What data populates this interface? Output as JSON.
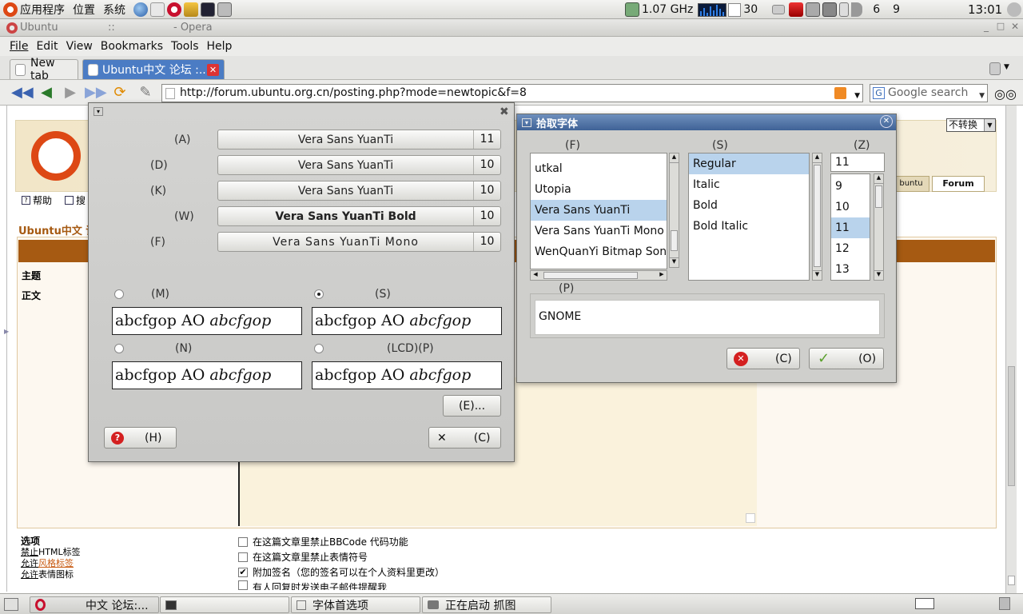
{
  "top_panel": {
    "menus": [
      "应用程序",
      "位置",
      "系统"
    ],
    "cpu_freq": "1.07 GHz",
    "cpu_value": "30",
    "tray_nums": [
      "6",
      "9"
    ],
    "clock": "13:01"
  },
  "window": {
    "title": "Ubuntu",
    "title_sep": "::",
    "app": "- Opera"
  },
  "menubar": [
    "File",
    "Edit",
    "View",
    "Bookmarks",
    "Tools",
    "Help"
  ],
  "tabs": [
    {
      "label": "New tab"
    },
    {
      "label": "Ubuntu中文 论坛 :..."
    }
  ],
  "address": {
    "url": "http://forum.ubuntu.org.cn/posting.php?mode=newtopic&f=8",
    "search_placeholder": "Google search"
  },
  "webpage": {
    "convert_select": "不转换",
    "tab_ubuntu": "buntu",
    "tab_forum": "Forum",
    "help_link": "帮助",
    "search_link": "搜",
    "section_title": "Ubuntu中文 论",
    "row_subject": "主题",
    "row_body": "正文",
    "options_title": "选项",
    "opt_links": [
      {
        "a": "禁止",
        "b": "HTML标签"
      },
      {
        "a": "允许",
        "b": "风格标签"
      },
      {
        "a": "允许",
        "b": "表情图标"
      }
    ],
    "checkboxes": [
      {
        "label": "在这篇文章里禁止BBCode 代码功能",
        "checked": false
      },
      {
        "label": "在这篇文章里禁止表情符号",
        "checked": false
      },
      {
        "label": "附加签名（您的签名可以在个人资料里更改）",
        "checked": true
      },
      {
        "label": "有人回复时发送电子邮件提醒我",
        "checked": false
      }
    ]
  },
  "font_prefs": {
    "rows": [
      {
        "key": "(A)",
        "font": "Vera Sans YuanTi",
        "size": "11",
        "style": "normal"
      },
      {
        "key": "(D)",
        "font": "Vera Sans YuanTi",
        "size": "10",
        "style": "normal"
      },
      {
        "key": "(K)",
        "font": "Vera Sans YuanTi",
        "size": "10",
        "style": "normal"
      },
      {
        "key": "(W)",
        "font": "Vera Sans YuanTi Bold",
        "size": "10",
        "style": "bold"
      },
      {
        "key": "(F)",
        "font": "Vera Sans YuanTi Mono",
        "size": "10",
        "style": "mono"
      }
    ],
    "render": [
      {
        "key": "(M)",
        "selected": false
      },
      {
        "key": "(S)",
        "selected": true
      },
      {
        "key": "(N)",
        "selected": false
      },
      {
        "key": "(LCD)(P)",
        "selected": false
      }
    ],
    "preview_a": "abcfgop AO ",
    "preview_b": "abcfgop",
    "details_btn": "(E)...",
    "help_btn": "(H)",
    "close_btn": "(C)"
  },
  "pick_font": {
    "title": "拾取字体",
    "family_key": "(F)",
    "style_key": "(S)",
    "size_key": "(Z)",
    "families": [
      "utkal",
      "Utopia",
      "Vera Sans YuanTi",
      "Vera Sans YuanTi Mono",
      "WenQuanYi Bitmap Son"
    ],
    "family_selected": 2,
    "styles": [
      "Regular",
      "Italic",
      "Bold",
      "Bold Italic"
    ],
    "style_selected": 0,
    "size_value": "11",
    "sizes": [
      "9",
      "10",
      "11",
      "12",
      "13"
    ],
    "size_selected": 2,
    "preview_key": "(P)",
    "preview_text": "GNOME",
    "cancel_btn": "(C)",
    "ok_btn": "(O)"
  },
  "taskbar": [
    {
      "label": "中文 论坛:..."
    },
    {
      "label": ""
    },
    {
      "label": "字体首选项"
    },
    {
      "label": "正在启动 抓图"
    }
  ],
  "colors": {
    "ubuntu_orange": "#dd4814",
    "forum_brown": "#a65a12",
    "selection": "#b9d3ec",
    "dialog_title": "#4b6d9d"
  }
}
